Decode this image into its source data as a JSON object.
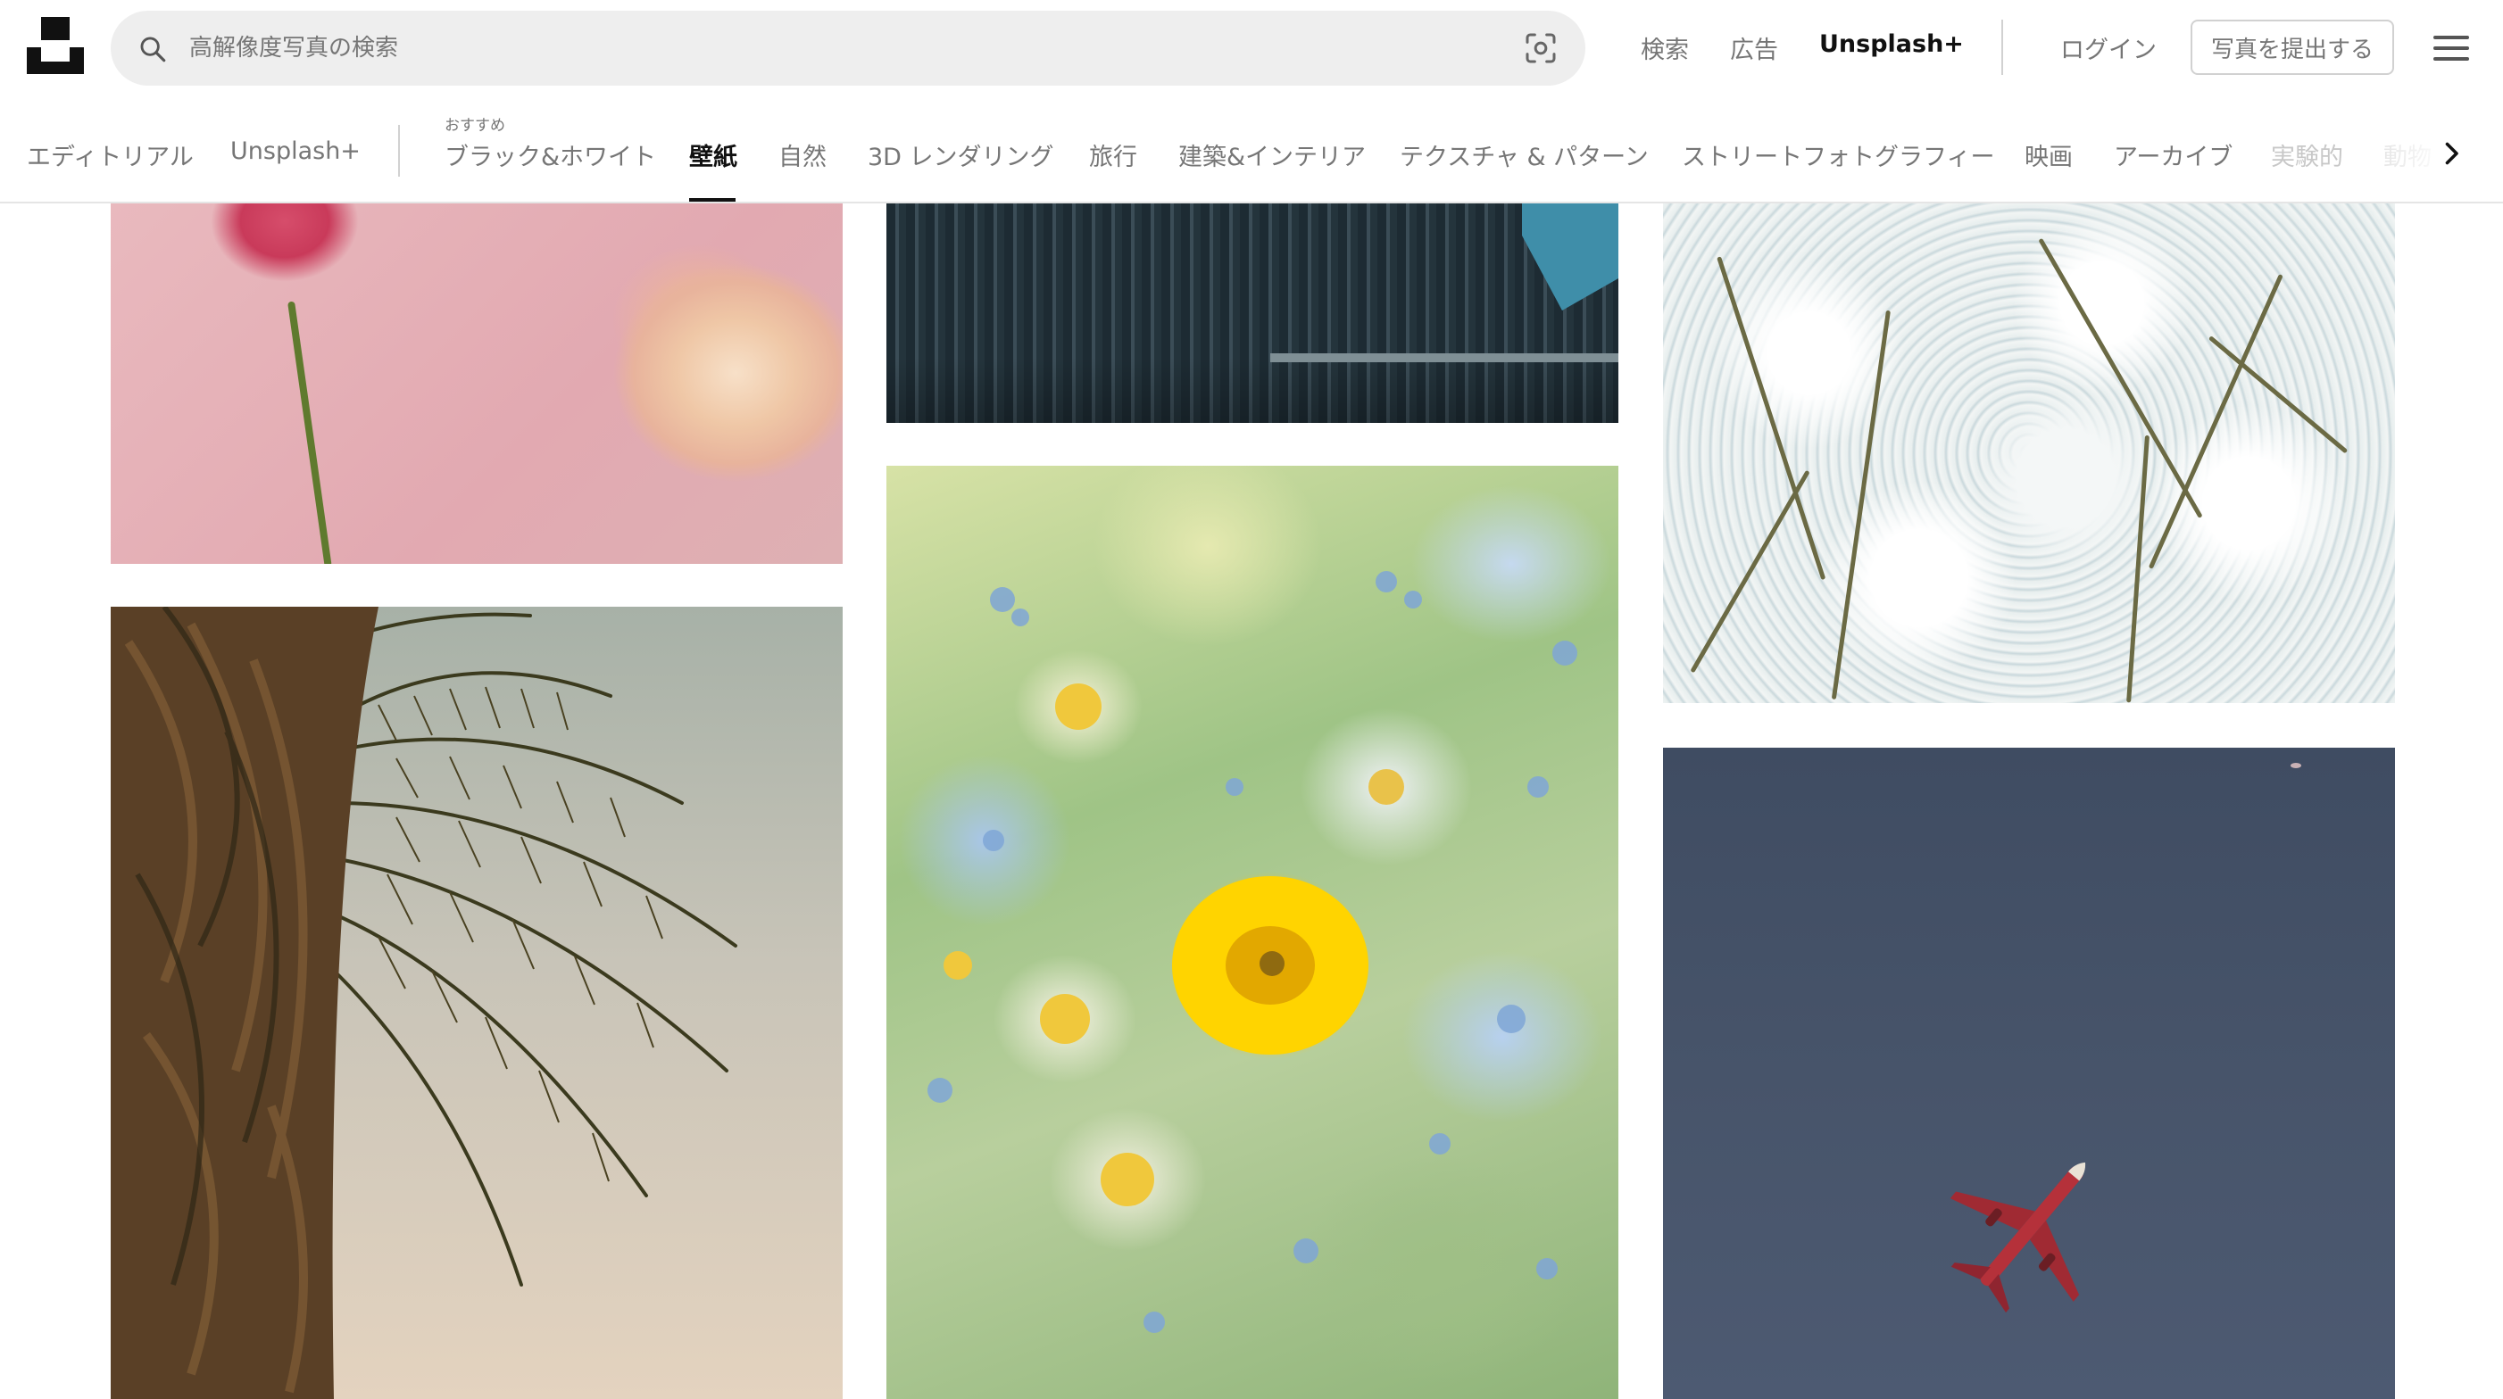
{
  "header": {
    "search_placeholder": "高解像度写真の検索",
    "nav": [
      "検索",
      "広告"
    ],
    "unsplash_plus": "Unsplash+",
    "login": "ログイン",
    "submit_photo": "写真を提出する"
  },
  "tabs": {
    "editorial": "エディトリアル",
    "unsplash_plus": "Unsplash+",
    "recommended_caption": "おすすめ",
    "items": [
      "ブラック&ホワイト",
      "壁紙",
      "自然",
      "3D レンダリング",
      "旅行",
      "建築&インテリア",
      "テクスチャ & パターン",
      "ストリートフォトグラフィー",
      "映画",
      "アーカイブ",
      "実験的",
      "動物"
    ],
    "active": "壁紙"
  },
  "photos": [
    {
      "name": "photo-ranunculus",
      "subject": "pink and peach ranunculus flowers"
    },
    {
      "name": "photo-palm",
      "subject": "palm tree fronds"
    },
    {
      "name": "photo-building",
      "subject": "dark glass office building"
    },
    {
      "name": "photo-daisies",
      "subject": "blurred daisies and yellow flower"
    },
    {
      "name": "photo-blossom",
      "subject": "white cherry blossom tree"
    },
    {
      "name": "photo-plane",
      "subject": "red airplane in blue sky"
    }
  ],
  "colors": {
    "text_primary": "#111111",
    "text_muted": "#767676",
    "search_bg": "#eeeeee",
    "border": "#d1d1d1"
  }
}
